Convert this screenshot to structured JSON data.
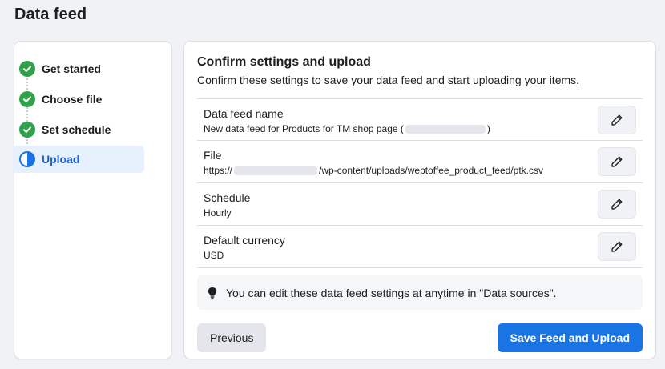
{
  "page_title": "Data feed",
  "steps": [
    {
      "label": "Get started",
      "status": "done",
      "icon": "check-circle-icon"
    },
    {
      "label": "Choose file",
      "status": "done",
      "icon": "check-circle-icon"
    },
    {
      "label": "Set schedule",
      "status": "done",
      "icon": "check-circle-icon"
    },
    {
      "label": "Upload",
      "status": "current",
      "icon": "half-circle-icon"
    }
  ],
  "main": {
    "heading": "Confirm settings and upload",
    "subheading": "Confirm these settings to save your data feed and start uploading your items.",
    "settings": [
      {
        "label": "Data feed name",
        "value_prefix": "New data feed for Products for TM shop page (",
        "value_suffix": ")"
      },
      {
        "label": "File",
        "value_prefix": "https://",
        "value_suffix": "/wp-content/uploads/webtoffee_product_feed/ptk.csv"
      },
      {
        "label": "Schedule",
        "value": "Hourly"
      },
      {
        "label": "Default currency",
        "value": "USD"
      }
    ],
    "tip": "You can edit these data feed settings at anytime in \"Data sources\".",
    "buttons": {
      "previous": "Previous",
      "save": "Save Feed and Upload"
    }
  },
  "colors": {
    "accent": "#1b74e4",
    "success": "#31a24c",
    "active_step_bg": "#e7f0fd"
  }
}
